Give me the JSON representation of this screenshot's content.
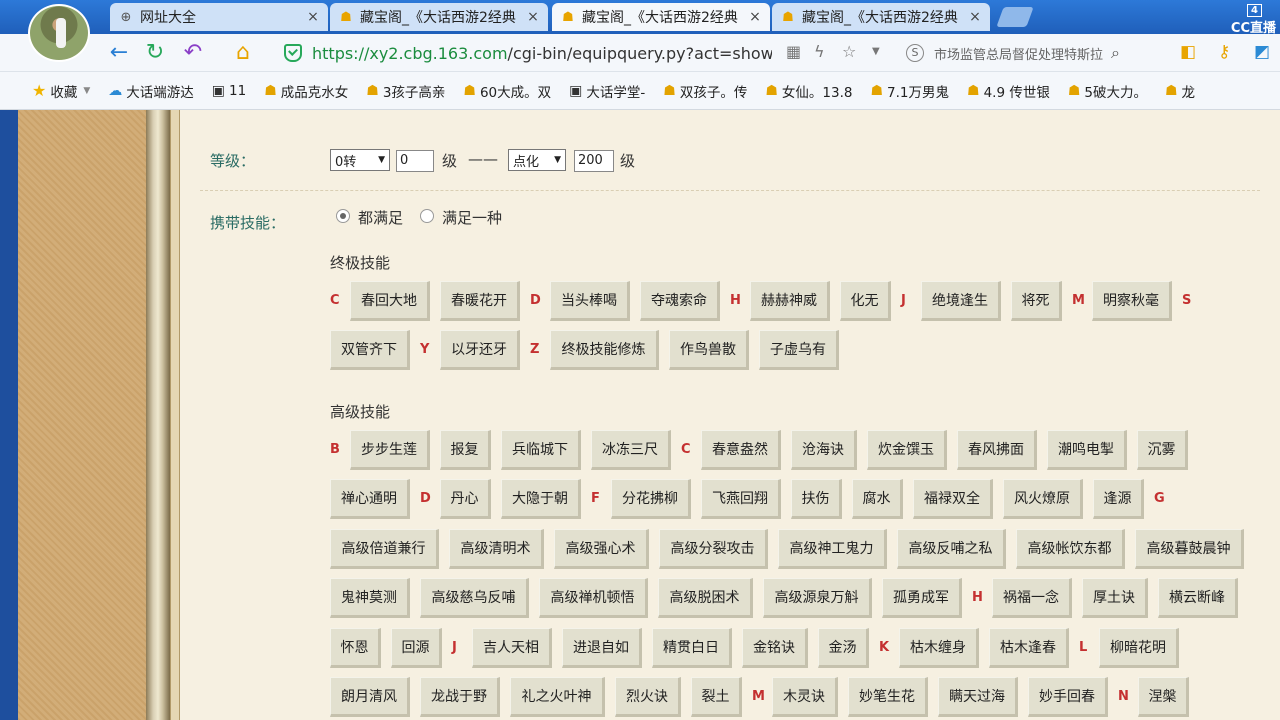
{
  "tabs": [
    {
      "title": "网址大全",
      "icon": "globe-icon"
    },
    {
      "title": "藏宝阁_《大话西游2经典",
      "icon": "cbg-icon"
    },
    {
      "title": "藏宝阁_《大话西游2经典",
      "icon": "cbg-icon"
    },
    {
      "title": "藏宝阁_《大话西游2经典",
      "icon": "cbg-icon"
    }
  ],
  "tab_close": "×",
  "cc_live": {
    "count": "4",
    "label": "CC直播"
  },
  "address": {
    "url_host": "https://xy2.cbg.163.com",
    "url_path": "/cgi-bin/equipquery.py?act=show_",
    "search_text": "市场监管总局督促处理特斯拉"
  },
  "bookmarks": [
    {
      "label": "收藏",
      "icon": "star-icon"
    },
    {
      "label": "大话端游达",
      "icon": "cloud-icon"
    },
    {
      "label": "11",
      "icon": "game-icon"
    },
    {
      "label": "成品克水女",
      "icon": "cbg-icon"
    },
    {
      "label": "3孩子高亲",
      "icon": "cbg-icon"
    },
    {
      "label": "60大成。双",
      "icon": "cbg-icon"
    },
    {
      "label": "大话学堂-",
      "icon": "game-icon"
    },
    {
      "label": "双孩子。传",
      "icon": "cbg-icon"
    },
    {
      "label": "女仙。13.8",
      "icon": "cbg-icon"
    },
    {
      "label": "7.1万男鬼",
      "icon": "cbg-icon"
    },
    {
      "label": "4.9 传世银",
      "icon": "cbg-icon"
    },
    {
      "label": "5破大力。",
      "icon": "cbg-icon"
    },
    {
      "label": "龙",
      "icon": "cbg-icon"
    }
  ],
  "form": {
    "level_label": "等级：",
    "level_from_select": "0转",
    "level_from_value": "0",
    "unit": "级",
    "dash": "——",
    "level_to_select": "点化",
    "level_to_value": "200",
    "skills_label": "携带技能：",
    "radio_all": "都满足",
    "radio_any": "满足一种"
  },
  "ultimate": {
    "title": "终极技能",
    "row1": [
      "C",
      "春回大地",
      "春暖花开",
      "D",
      "当头棒喝",
      "夺魂索命",
      "H",
      "赫赫神威",
      "化无",
      "J",
      "绝境逢生",
      "将死",
      "M",
      "明察秋毫",
      "S"
    ],
    "row2": [
      "双管齐下",
      "Y",
      "以牙还牙",
      "Z",
      "终极技能修炼",
      "作鸟兽散",
      "子虚乌有"
    ]
  },
  "advanced": {
    "title": "高级技能",
    "row1": [
      "B",
      "步步生莲",
      "报复",
      "兵临城下",
      "冰冻三尺",
      "C",
      "春意盎然",
      "沧海诀",
      "炊金馔玉",
      "春风拂面",
      "潮鸣电掣",
      "沉雾"
    ],
    "row2": [
      "禅心通明",
      "D",
      "丹心",
      "大隐于朝",
      "F",
      "分花拂柳",
      "飞燕回翔",
      "扶伤",
      "腐水",
      "福禄双全",
      "风火燎原",
      "逢源",
      "G"
    ],
    "row3": [
      "高级倍道兼行",
      "高级清明术",
      "高级强心术",
      "高级分裂攻击",
      "高级神工鬼力",
      "高级反哺之私",
      "高级帐饮东都",
      "高级暮鼓晨钟"
    ],
    "row4": [
      "鬼神莫测",
      "高级慈乌反哺",
      "高级禅机顿悟",
      "高级脱困术",
      "高级源泉万斛",
      "孤勇成军",
      "H",
      "祸福一念",
      "厚土诀",
      "横云断峰"
    ],
    "row5": [
      "怀恩",
      "回源",
      "J",
      "吉人天相",
      "进退自如",
      "精贯白日",
      "金铭诀",
      "金汤",
      "K",
      "枯木缠身",
      "枯木逢春",
      "L",
      "柳暗花明"
    ],
    "row6": [
      "朗月清风",
      "龙战于野",
      "礼之火叶神",
      "烈火诀",
      "裂土",
      "M",
      "木灵诀",
      "妙笔生花",
      "瞒天过海",
      "妙手回春",
      "N",
      "涅槃"
    ]
  }
}
